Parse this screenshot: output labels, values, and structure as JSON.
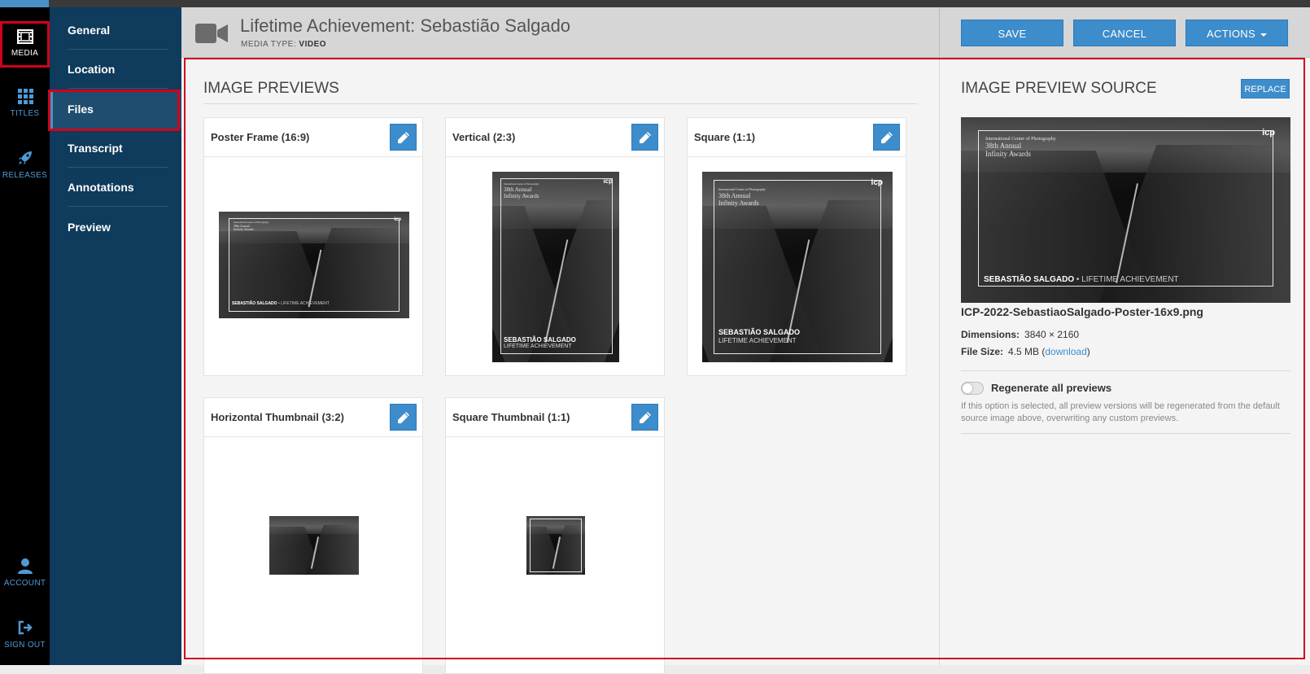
{
  "rail": {
    "items": [
      {
        "label": "MEDIA",
        "icon": "film-icon"
      },
      {
        "label": "TITLES",
        "icon": "grid-icon"
      },
      {
        "label": "RELEASES",
        "icon": "rocket-icon"
      },
      {
        "label": "ACCOUNT",
        "icon": "user-icon"
      },
      {
        "label": "SIGN OUT",
        "icon": "sign-out-icon"
      }
    ]
  },
  "subnav": {
    "items": [
      "General",
      "Location",
      "Files",
      "Transcript",
      "Annotations",
      "Preview"
    ],
    "active": "Files"
  },
  "header": {
    "title": "Lifetime Achievement: Sebastião Salgado",
    "media_type_label": "MEDIA TYPE:",
    "media_type_value": "VIDEO",
    "save_label": "SAVE",
    "cancel_label": "CANCEL",
    "actions_label": "ACTIONS"
  },
  "previews": {
    "title": "IMAGE PREVIEWS",
    "cards": [
      {
        "label": "Poster Frame (16:9)"
      },
      {
        "label": "Vertical (2:3)"
      },
      {
        "label": "Square (1:1)"
      },
      {
        "label": "Horizontal Thumbnail (3:2)"
      },
      {
        "label": "Square Thumbnail (1:1)"
      }
    ]
  },
  "source": {
    "title": "IMAGE PREVIEW SOURCE",
    "replace_label": "REPLACE",
    "filename": "ICP-2022-SebastiaoSalgado-Poster-16x9.png",
    "dimensions_label": "Dimensions:",
    "dimensions_value": "3840 × 2160",
    "filesize_label": "File Size:",
    "filesize_value": "4.5 MB (",
    "download_label": "download",
    "filesize_close": ")",
    "regenerate_label": "Regenerate all previews",
    "regenerate_enabled": false,
    "help_text": "If this option is selected, all preview versions will be regenerated from the default source image above, overwriting any custom previews."
  },
  "poster": {
    "org": "International Center of Photography",
    "edition": "38th Annual",
    "event": "Infinity Awards",
    "name": "SEBASTIÃO SALGADO",
    "separator": " • ",
    "honor": "LIFETIME ACHIEVEMENT",
    "logo": "icp"
  },
  "colors": {
    "accent": "#3d8ccb",
    "rail_bg": "#000000",
    "subnav_bg": "#0f3b5c",
    "highlight": "#d0021b"
  }
}
